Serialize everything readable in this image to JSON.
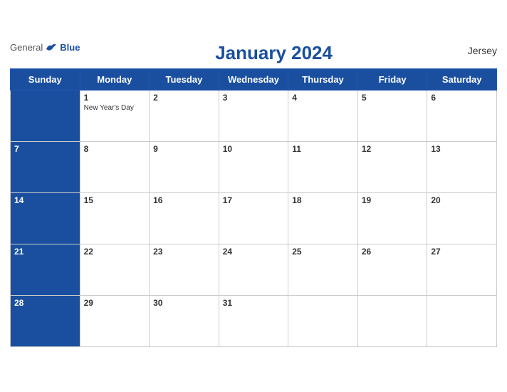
{
  "header": {
    "logo_general": "General",
    "logo_blue": "Blue",
    "title": "January 2024",
    "country": "Jersey"
  },
  "weekdays": [
    "Sunday",
    "Monday",
    "Tuesday",
    "Wednesday",
    "Thursday",
    "Friday",
    "Saturday"
  ],
  "weeks": [
    [
      {
        "day": "",
        "empty": true
      },
      {
        "day": "1",
        "holiday": "New Year's Day"
      },
      {
        "day": "2",
        "holiday": ""
      },
      {
        "day": "3",
        "holiday": ""
      },
      {
        "day": "4",
        "holiday": ""
      },
      {
        "day": "5",
        "holiday": ""
      },
      {
        "day": "6",
        "holiday": ""
      }
    ],
    [
      {
        "day": "7",
        "holiday": ""
      },
      {
        "day": "8",
        "holiday": ""
      },
      {
        "day": "9",
        "holiday": ""
      },
      {
        "day": "10",
        "holiday": ""
      },
      {
        "day": "11",
        "holiday": ""
      },
      {
        "day": "12",
        "holiday": ""
      },
      {
        "day": "13",
        "holiday": ""
      }
    ],
    [
      {
        "day": "14",
        "holiday": ""
      },
      {
        "day": "15",
        "holiday": ""
      },
      {
        "day": "16",
        "holiday": ""
      },
      {
        "day": "17",
        "holiday": ""
      },
      {
        "day": "18",
        "holiday": ""
      },
      {
        "day": "19",
        "holiday": ""
      },
      {
        "day": "20",
        "holiday": ""
      }
    ],
    [
      {
        "day": "21",
        "holiday": ""
      },
      {
        "day": "22",
        "holiday": ""
      },
      {
        "day": "23",
        "holiday": ""
      },
      {
        "day": "24",
        "holiday": ""
      },
      {
        "day": "25",
        "holiday": ""
      },
      {
        "day": "26",
        "holiday": ""
      },
      {
        "day": "27",
        "holiday": ""
      }
    ],
    [
      {
        "day": "28",
        "holiday": ""
      },
      {
        "day": "29",
        "holiday": ""
      },
      {
        "day": "30",
        "holiday": ""
      },
      {
        "day": "31",
        "holiday": ""
      },
      {
        "day": "",
        "empty": true
      },
      {
        "day": "",
        "empty": true
      },
      {
        "day": "",
        "empty": true
      }
    ]
  ]
}
